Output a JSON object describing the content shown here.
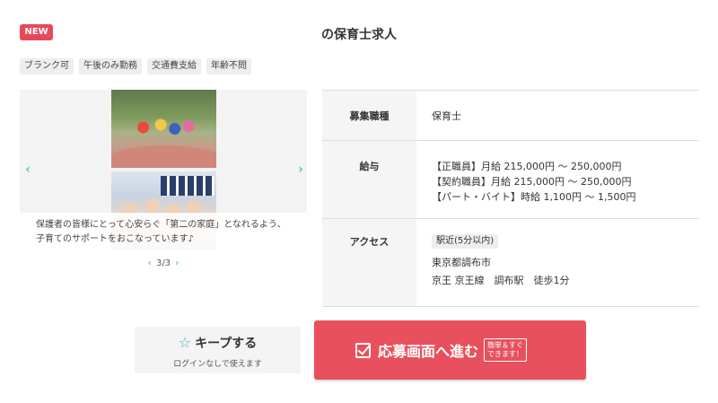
{
  "badge": {
    "new": "NEW"
  },
  "title": "の保育士求人",
  "tags": [
    "ブランク可",
    "午後のみ勤務",
    "交通費支給",
    "年齢不問"
  ],
  "carousel": {
    "caption_line1": "保護者の皆様にとって心安らぐ「第二の家庭」となれるよう、",
    "caption_line2": "子育てのサポートをおこなっています♪",
    "pager": "3/3",
    "prev_arrow": "‹",
    "next_arrow": "›",
    "pager_prev": "‹",
    "pager_next": "›"
  },
  "info": {
    "job_type_label": "募集職種",
    "job_type_value": "保育士",
    "salary_label": "給与",
    "salary_lines": [
      "【正職員】月給 215,000円 ～ 250,000円",
      "【契約職員】月給 215,000円 ～ 250,000円",
      "【パート・バイト】時給 1,100円 ～ 1,500円"
    ],
    "access_label": "アクセス",
    "access_badge": "駅近(5分以内)",
    "access_city": "東京都調布市",
    "access_station": "京王 京王線　調布駅　徒歩1分"
  },
  "keep": {
    "label": "キープする",
    "sub": "ログインなしで使えます",
    "icon": "star-outline-icon"
  },
  "apply": {
    "label": "応募画面へ進む",
    "note_line1": "簡単＆すぐ",
    "note_line2": "できます！",
    "icon": "checkbox-icon"
  },
  "colors": {
    "accent": "#e9505d",
    "badge_new": "#e8495a",
    "teal": "#2bb5b0"
  }
}
